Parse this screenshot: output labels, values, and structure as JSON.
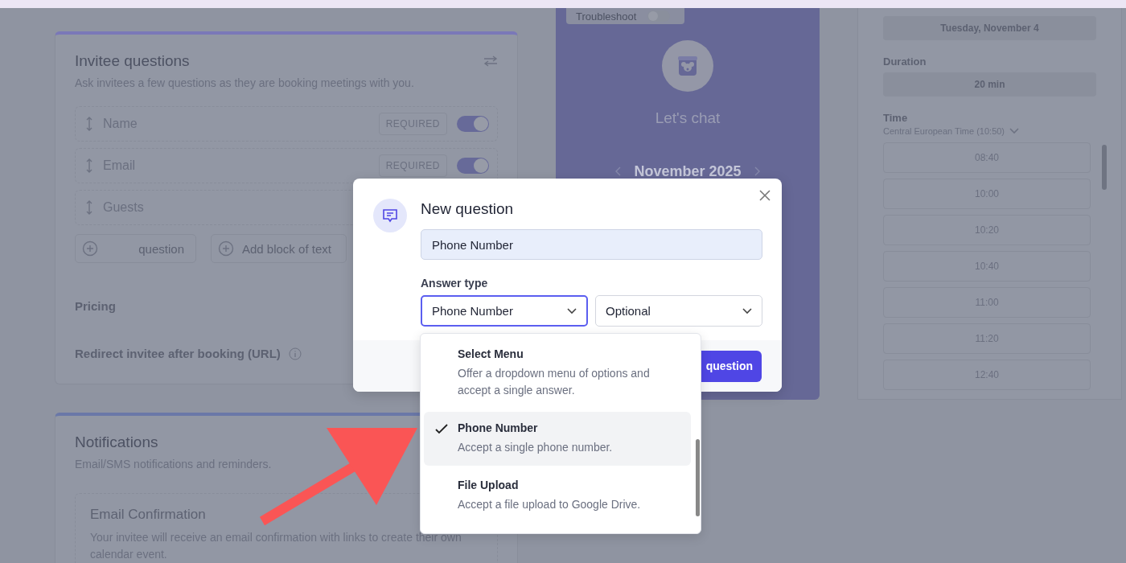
{
  "troubleshoot": {
    "label": "Troubleshoot",
    "on": false
  },
  "invitee_questions": {
    "title": "Invitee questions",
    "subtitle": "Ask invitees a few questions as they are booking meetings with you.",
    "questions": [
      {
        "label": "Name",
        "badge": "REQUIRED",
        "on": true
      },
      {
        "label": "Email",
        "badge": "REQUIRED",
        "on": true
      },
      {
        "label": "Guests"
      }
    ],
    "buttons": [
      "question",
      "Add block of text"
    ],
    "pricing": "Pricing",
    "redirect": "Redirect invitee after booking (URL)"
  },
  "notifications": {
    "title": "Notifications",
    "subtitle": "Email/SMS notifications and reminders.",
    "email_confirmation": {
      "title": "Email Confirmation",
      "text": "Your invitee will receive an email confirmation with links to create their own calendar event."
    }
  },
  "preview": {
    "title": "Let's chat",
    "month": "November 2025"
  },
  "booking": {
    "date": "Tuesday, November 4",
    "duration_label": "Duration",
    "duration": "20 min",
    "time_label": "Time",
    "timezone": "Central European Time (10:50)",
    "slots": [
      "08:40",
      "10:00",
      "10:20",
      "10:40",
      "11:00",
      "11:20",
      "12:40"
    ]
  },
  "modal": {
    "title": "New question",
    "question_value": "Phone Number",
    "answer_type_label": "Answer type",
    "answer_type": "Phone Number",
    "requirement": "Optional",
    "submit": "question"
  },
  "dropdown": [
    {
      "title": "Select Menu",
      "description": "Offer a dropdown menu of options and accept a single answer.",
      "selected": false
    },
    {
      "title": "Phone Number",
      "description": "Accept a single phone number.",
      "selected": true
    },
    {
      "title": "File Upload",
      "description": "Accept a file upload to Google Drive.",
      "selected": false
    }
  ]
}
